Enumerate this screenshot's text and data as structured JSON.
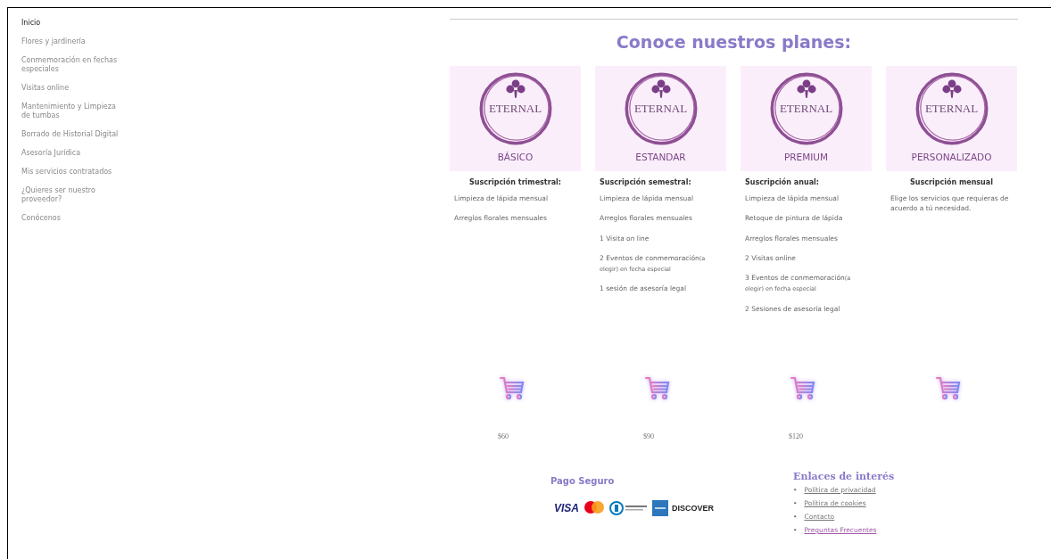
{
  "sidebar": {
    "items": [
      {
        "label": "Inicio",
        "selected": true
      },
      {
        "label": "Flores y jardinería",
        "selected": false
      },
      {
        "label": "Conmemoración en fechas especiales",
        "selected": false
      },
      {
        "label": "Visitas online",
        "selected": false
      },
      {
        "label": "Mantenimiento y Limpieza de tumbas",
        "selected": false
      },
      {
        "label": "Borrado de Historial Digital",
        "selected": false
      },
      {
        "label": "Asesoría Jurídica",
        "selected": false
      },
      {
        "label": "Mis servicios contratados",
        "selected": false
      },
      {
        "label": "¿Quieres ser nuestro proveedor?",
        "selected": false
      },
      {
        "label": "Conócenos",
        "selected": false
      }
    ]
  },
  "heading": "Conoce nuestros planes:",
  "plans": [
    {
      "logo_text": "ETERNAL",
      "name": "BÁSICO",
      "subtitle": "Suscripción trimestral:",
      "subtitle_centered": true,
      "features": [
        {
          "text": "Limpieza de lápida mensual"
        },
        {
          "text": "Arreglos florales mensuales"
        }
      ],
      "price": "$60"
    },
    {
      "logo_text": "ETERNAL",
      "name": "ESTANDAR",
      "subtitle": "Suscripción semestral:",
      "subtitle_centered": false,
      "features": [
        {
          "text": "Limpieza de lápida mensual"
        },
        {
          "text": "Arreglos florales mensuales"
        },
        {
          "text": "1 Visita on line"
        },
        {
          "text": "2 Eventos de conmemoración",
          "note": "(a elegir) en fecha especial"
        },
        {
          "text": "1 sesión de asesoría legal"
        }
      ],
      "price": "$90"
    },
    {
      "logo_text": "ETERNAL",
      "name": "PREMIUM",
      "subtitle": "Suscripción anual:",
      "subtitle_centered": false,
      "features": [
        {
          "text": "Limpieza de lápida mensual"
        },
        {
          "text": "Retoque de pintura de lápida"
        },
        {
          "text": "Arreglos florales mensuales"
        },
        {
          "text": "2 Visitas online"
        },
        {
          "text": "3 Eventos de conmemoración",
          "note": "(a elegir) en fecha especial"
        },
        {
          "text": "2 Sesiones de asesoría legal"
        }
      ],
      "price": "$120"
    },
    {
      "logo_text": "ETERNAL",
      "name": "PERSONALIZADO",
      "subtitle": "Suscripción mensual",
      "subtitle_centered": true,
      "features": [
        {
          "text": "Elige los servicios que requieras de acuerdo a tú necesidad."
        }
      ]
    }
  ],
  "payment": {
    "title": "Pago Seguro",
    "cards": [
      {
        "kind": "visa",
        "label": "VISA"
      },
      {
        "kind": "mastercard"
      },
      {
        "kind": "diners"
      },
      {
        "kind": "amex"
      },
      {
        "kind": "discover",
        "label": "DISCOVER"
      }
    ]
  },
  "links": {
    "title": "Enlaces de interés",
    "items": [
      {
        "marker": "•",
        "label": "Política de privacidad"
      },
      {
        "marker": "•",
        "label": "Política de cookies"
      },
      {
        "marker": "•",
        "label": "Contacto"
      },
      {
        "marker": "•",
        "label": "Preguntas Frecuentes"
      }
    ]
  }
}
